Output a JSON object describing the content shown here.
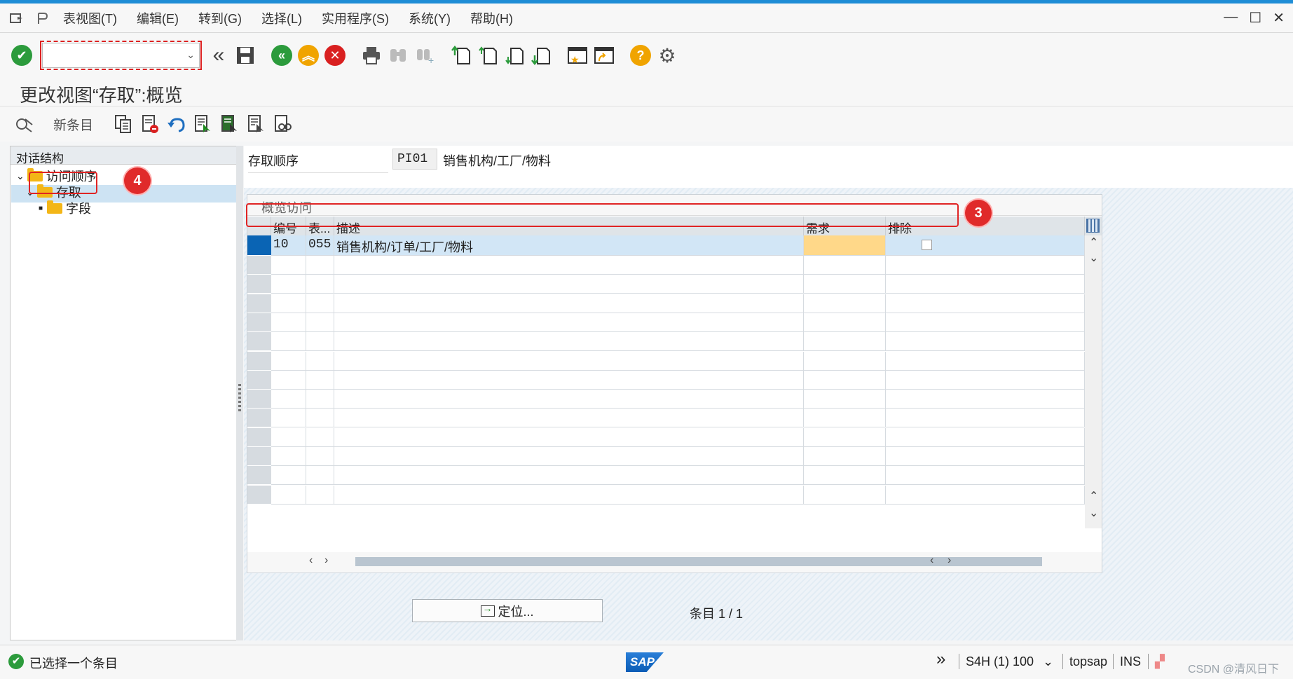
{
  "menubar": {
    "items": [
      "表视图(T)",
      "编辑(E)",
      "转到(G)",
      "选择(L)",
      "实用程序(S)",
      "系统(Y)",
      "帮助(H)"
    ]
  },
  "window_controls": [
    "minimize-icon",
    "maximize-icon",
    "close-icon"
  ],
  "toolbar": {
    "command_field_value": "",
    "icons": [
      "enter-icon",
      "back-double-icon",
      "save-icon",
      "back-icon",
      "exit-icon",
      "cancel-icon",
      "print-icon",
      "find-icon",
      "find-next-icon",
      "first-page-icon",
      "prev-page-icon",
      "next-page-icon",
      "last-page-icon",
      "create-session-icon",
      "shortcut-icon",
      "help-icon",
      "settings-icon"
    ]
  },
  "title": "更改视图“存取”:概览",
  "app_toolbar": {
    "new_entries": "新条目",
    "icons": [
      "display-change-icon",
      "copy-icon",
      "delete-icon",
      "undo-icon",
      "select-all-icon",
      "select-block-icon",
      "deselect-all-icon",
      "compare-icon"
    ]
  },
  "tree": {
    "header": "对话结构",
    "items": [
      {
        "label": "访问顺序",
        "level": 0,
        "expanded": true
      },
      {
        "label": "存取",
        "level": 1,
        "expanded": true,
        "selected": true
      },
      {
        "label": "字段",
        "level": 2,
        "expanded": false
      }
    ]
  },
  "header": {
    "label": "存取顺序",
    "key": "PI01",
    "description": "销售机构/工厂/物料"
  },
  "table": {
    "title": "概览访问",
    "columns": [
      "编号",
      "表...",
      "描述",
      "需求",
      "排除"
    ],
    "rows": [
      {
        "no": "10",
        "table": "055",
        "desc": "销售机构/订单/工厂/物料",
        "need": "",
        "exclude": false
      }
    ],
    "empty_rows": 13
  },
  "locate_button": "定位...",
  "entry_counter": "条目 1 / 1",
  "statusbar": {
    "message": "已选择一个条目",
    "system": "S4H (1) 100",
    "host": "topsap",
    "mode": "INS",
    "watermark": "CSDN @清风日下"
  },
  "annotations": {
    "badge_3": "3",
    "badge_4": "4",
    "color": "#e02424"
  },
  "colors": {
    "accent": "#1e8dd6",
    "selection": "#cde3f3",
    "need_cell": "#ffd889",
    "folder": "#f3b617"
  }
}
